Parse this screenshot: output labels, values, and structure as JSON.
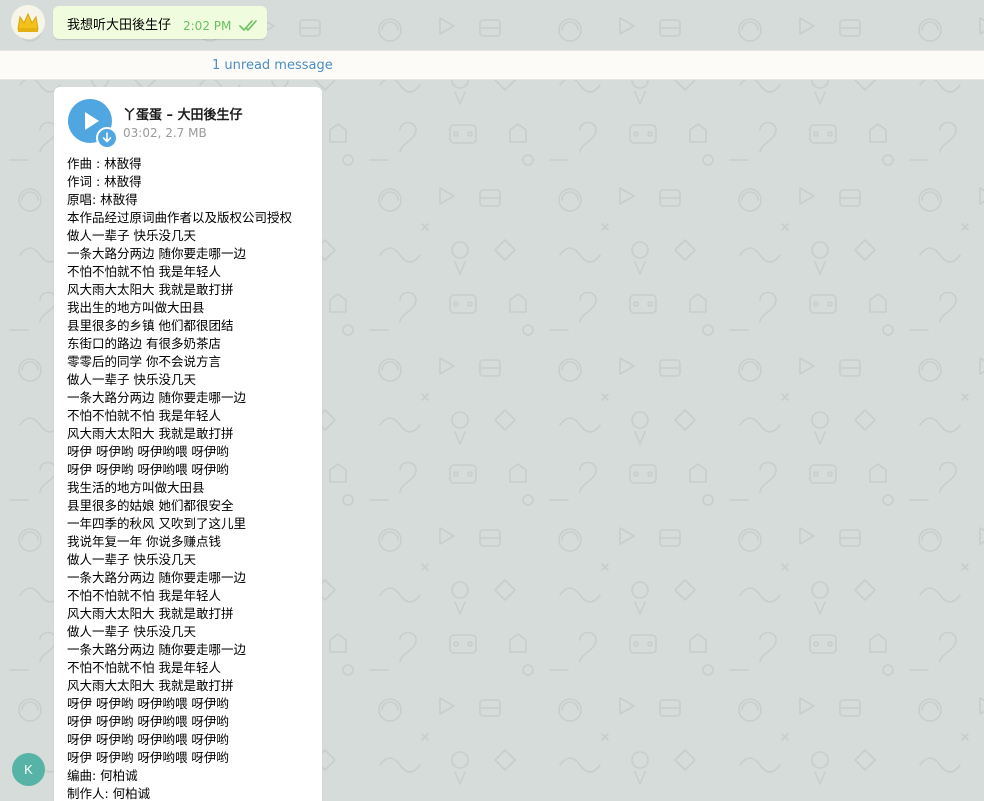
{
  "outgoing_message": {
    "text": "我想听大田後生仔",
    "time": "2:02 PM",
    "status_icon": "double-check-icon"
  },
  "unread_divider": {
    "label": "1 unread message"
  },
  "incoming_audio": {
    "title": "丫蛋蛋 – 大田後生仔",
    "meta": "03:02, 2.7 MB",
    "play_icon": "play-icon",
    "download_icon": "download-arrow-icon",
    "lyrics": [
      "作曲 : 林敔得",
      "作词 : 林敔得",
      "原唱:  林敔得",
      "本作品经过原词曲作者以及版权公司授权",
      "做人一辈子 快乐没几天",
      "一条大路分两边 随你要走哪一边",
      "不怕不怕就不怕 我是年轻人",
      "风大雨大太阳大 我就是敢打拼",
      "我出生的地方叫做大田县",
      "县里很多的乡镇 他们都很团结",
      "东街口的路边 有很多奶茶店",
      "零零后的同学 你不会说方言",
      "做人一辈子 快乐没几天",
      "一条大路分两边 随你要走哪一边",
      "不怕不怕就不怕 我是年轻人",
      "风大雨大太阳大 我就是敢打拼",
      "呀伊 呀伊哟 呀伊哟喂 呀伊哟",
      "呀伊 呀伊哟 呀伊哟喂 呀伊哟",
      "我生活的地方叫做大田县",
      "县里很多的姑娘 她们都很安全",
      "一年四季的秋风 又吹到了这儿里",
      "我说年复一年 你说多赚点钱",
      "做人一辈子 快乐没几天",
      "一条大路分两边 随你要走哪一边",
      "不怕不怕就不怕 我是年轻人",
      "风大雨大太阳大 我就是敢打拼",
      "做人一辈子 快乐没几天",
      "一条大路分两边 随你要走哪一边",
      "不怕不怕就不怕 我是年轻人",
      "风大雨大太阳大 我就是敢打拼",
      "呀伊 呀伊哟 呀伊哟喂 呀伊哟",
      "呀伊 呀伊哟 呀伊哟喂 呀伊哟",
      "呀伊 呀伊哟 呀伊哟喂 呀伊哟",
      "呀伊 呀伊哟 呀伊哟喂 呀伊哟",
      "编曲:  何柏诚",
      "制作人:  何柏诚"
    ]
  },
  "sender_avatar": {
    "initial": "K",
    "color": "#56b3a5"
  },
  "colors": {
    "chat_background": "#d6dcd9",
    "outgoing_bubble": "#effdde",
    "accent_blue": "#4fa6e1",
    "link_blue": "#4a8ec3",
    "read_green": "#6cbf62"
  }
}
